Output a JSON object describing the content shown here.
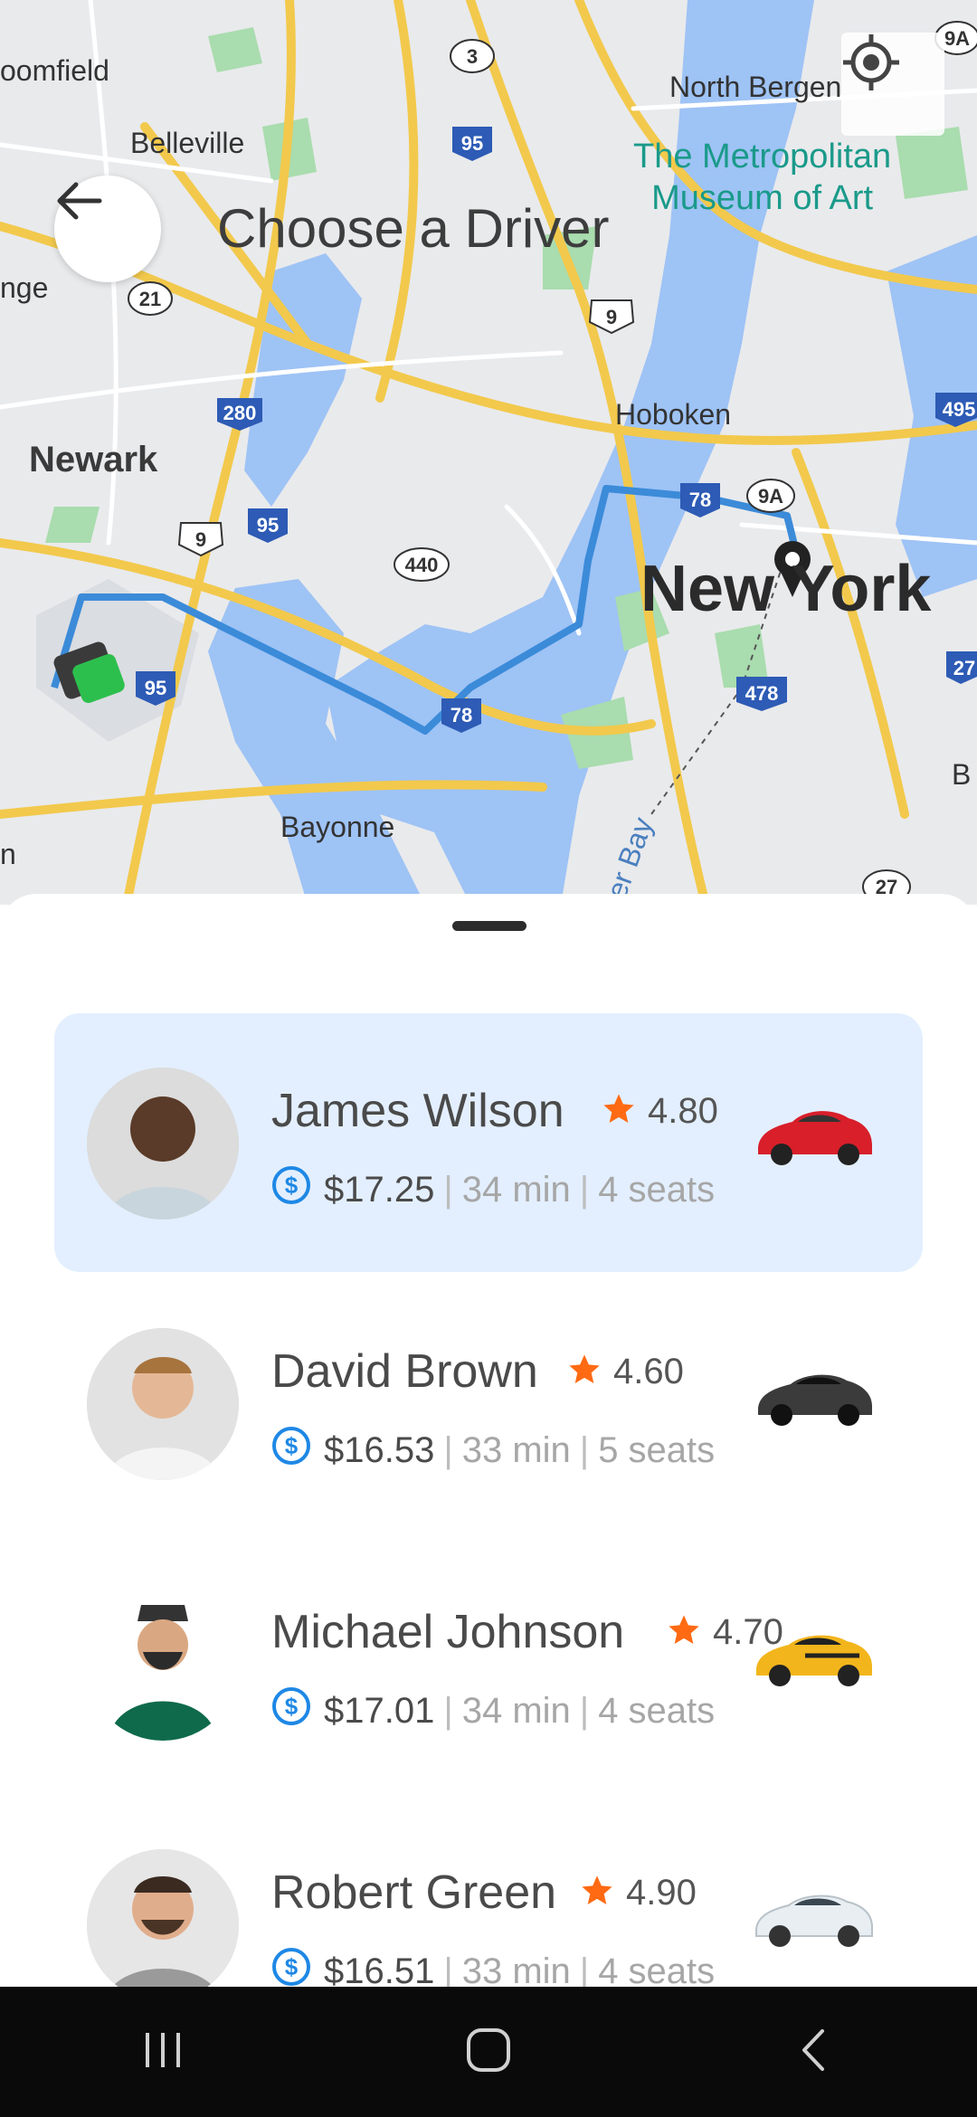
{
  "header": {
    "title": "Choose a Driver",
    "back_icon": "arrow-left-icon",
    "locate_icon": "my-location-icon"
  },
  "map": {
    "labels": {
      "bloomfield": "oomfield",
      "belleville": "Belleville",
      "orange": "nge",
      "newark": "Newark",
      "north_bergen": "North Bergen",
      "metropolitan": "The Metropolitan\nMuseum of Art",
      "hoboken": "Hoboken",
      "new_york": "New York",
      "bayonne": "Bayonne",
      "bay": "er Bay",
      "b_edge": "B",
      "n_edge": "n"
    },
    "shields": [
      "3",
      "95",
      "21",
      "9",
      "280",
      "9",
      "95",
      "440",
      "78",
      "9A",
      "95",
      "78",
      "478",
      "495",
      "27",
      "27",
      "9A"
    ]
  },
  "drivers": [
    {
      "name": "James Wilson",
      "rating": "4.80",
      "price": "$17.25",
      "time": "34 min",
      "seats": "4 seats",
      "car_color": "#d81f2a",
      "selected": true
    },
    {
      "name": "David Brown",
      "rating": "4.60",
      "price": "$16.53",
      "time": "33 min",
      "seats": "5 seats",
      "car_color": "#3b3b3b",
      "selected": false
    },
    {
      "name": "Michael Johnson",
      "rating": "4.70",
      "price": "$17.01",
      "time": "34 min",
      "seats": "4 seats",
      "car_color": "#f2b51c",
      "selected": false
    },
    {
      "name": "Robert Green",
      "rating": "4.90",
      "price": "$16.51",
      "time": "33 min",
      "seats": "4 seats",
      "car_color": "#e8eef2",
      "selected": false
    }
  ],
  "separator": "|",
  "colors": {
    "accent": "#1e88e5",
    "star": "#ff6a13",
    "selected_bg": "#e3efff",
    "route": "#3b8bd9"
  },
  "navbar": {
    "recents_icon": "recents-icon",
    "home_icon": "home-icon",
    "back_icon": "back-chevron-icon"
  }
}
